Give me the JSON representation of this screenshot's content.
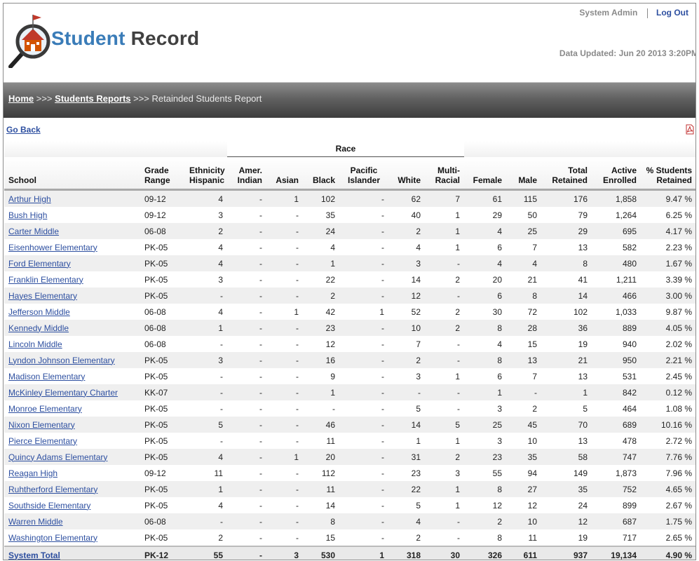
{
  "header": {
    "logo_word1": "Student",
    "logo_word2": "Record",
    "user": "System Admin",
    "logout": "Log Out",
    "updated": "Data Updated: Jun 20 2013 3:20PM"
  },
  "breadcrumb": {
    "home": "Home",
    "sep": ">>>",
    "reports": "Students Reports",
    "current": "Retainded Students Report"
  },
  "goback": "Go Back",
  "icons": {
    "pdf": "pdf-icon",
    "logo": "schoolhouse-magnifier-icon"
  },
  "colors": {
    "link": "#2d4fa0",
    "logo_blue": "#3a7cb8",
    "bar_dark": "#3d3d3d"
  },
  "table": {
    "race_header": "Race",
    "columns": [
      "School",
      "Grade Range",
      "Ethnicity Hispanic",
      "Amer. Indian",
      "Asian",
      "Black",
      "Pacific Islander",
      "White",
      "Multi-Racial",
      "Female",
      "Male",
      "Total Retained",
      "Active Enrolled",
      "% Students Retained"
    ],
    "rows": [
      [
        "Arthur High",
        "09-12",
        "4",
        "-",
        "1",
        "102",
        "-",
        "62",
        "7",
        "61",
        "115",
        "176",
        "1,858",
        "9.47 %"
      ],
      [
        "Bush High",
        "09-12",
        "3",
        "-",
        "-",
        "35",
        "-",
        "40",
        "1",
        "29",
        "50",
        "79",
        "1,264",
        "6.25 %"
      ],
      [
        "Carter Middle",
        "06-08",
        "2",
        "-",
        "-",
        "24",
        "-",
        "2",
        "1",
        "4",
        "25",
        "29",
        "695",
        "4.17 %"
      ],
      [
        "Eisenhower Elementary",
        "PK-05",
        "4",
        "-",
        "-",
        "4",
        "-",
        "4",
        "1",
        "6",
        "7",
        "13",
        "582",
        "2.23 %"
      ],
      [
        "Ford Elementary",
        "PK-05",
        "4",
        "-",
        "-",
        "1",
        "-",
        "3",
        "-",
        "4",
        "4",
        "8",
        "480",
        "1.67 %"
      ],
      [
        "Franklin Elementary",
        "PK-05",
        "3",
        "-",
        "-",
        "22",
        "-",
        "14",
        "2",
        "20",
        "21",
        "41",
        "1,211",
        "3.39 %"
      ],
      [
        "Hayes Elementary",
        "PK-05",
        "-",
        "-",
        "-",
        "2",
        "-",
        "12",
        "-",
        "6",
        "8",
        "14",
        "466",
        "3.00 %"
      ],
      [
        "Jefferson Middle",
        "06-08",
        "4",
        "-",
        "1",
        "42",
        "1",
        "52",
        "2",
        "30",
        "72",
        "102",
        "1,033",
        "9.87 %"
      ],
      [
        "Kennedy Middle",
        "06-08",
        "1",
        "-",
        "-",
        "23",
        "-",
        "10",
        "2",
        "8",
        "28",
        "36",
        "889",
        "4.05 %"
      ],
      [
        "Lincoln Middle",
        "06-08",
        "-",
        "-",
        "-",
        "12",
        "-",
        "7",
        "-",
        "4",
        "15",
        "19",
        "940",
        "2.02 %"
      ],
      [
        "Lyndon Johnson Elementary",
        "PK-05",
        "3",
        "-",
        "-",
        "16",
        "-",
        "2",
        "-",
        "8",
        "13",
        "21",
        "950",
        "2.21 %"
      ],
      [
        "Madison Elementary",
        "PK-05",
        "-",
        "-",
        "-",
        "9",
        "-",
        "3",
        "1",
        "6",
        "7",
        "13",
        "531",
        "2.45 %"
      ],
      [
        "McKinley Elementary Charter",
        "KK-07",
        "-",
        "-",
        "-",
        "1",
        "-",
        "-",
        "-",
        "1",
        "-",
        "1",
        "842",
        "0.12 %"
      ],
      [
        "Monroe Elementary",
        "PK-05",
        "-",
        "-",
        "-",
        "-",
        "-",
        "5",
        "-",
        "3",
        "2",
        "5",
        "464",
        "1.08 %"
      ],
      [
        "Nixon Elementary",
        "PK-05",
        "5",
        "-",
        "-",
        "46",
        "-",
        "14",
        "5",
        "25",
        "45",
        "70",
        "689",
        "10.16 %"
      ],
      [
        "Pierce Elementary",
        "PK-05",
        "-",
        "-",
        "-",
        "11",
        "-",
        "1",
        "1",
        "3",
        "10",
        "13",
        "478",
        "2.72 %"
      ],
      [
        "Quincy Adams Elementary",
        "PK-05",
        "4",
        "-",
        "1",
        "20",
        "-",
        "31",
        "2",
        "23",
        "35",
        "58",
        "747",
        "7.76 %"
      ],
      [
        "Reagan High",
        "09-12",
        "11",
        "-",
        "-",
        "112",
        "-",
        "23",
        "3",
        "55",
        "94",
        "149",
        "1,873",
        "7.96 %"
      ],
      [
        "Ruhtherford Elementary",
        "PK-05",
        "1",
        "-",
        "-",
        "11",
        "-",
        "22",
        "1",
        "8",
        "27",
        "35",
        "752",
        "4.65 %"
      ],
      [
        "Southside Elementary",
        "PK-05",
        "4",
        "-",
        "-",
        "14",
        "-",
        "5",
        "1",
        "12",
        "12",
        "24",
        "899",
        "2.67 %"
      ],
      [
        "Warren Middle",
        "06-08",
        "-",
        "-",
        "-",
        "8",
        "-",
        "4",
        "-",
        "2",
        "10",
        "12",
        "687",
        "1.75 %"
      ],
      [
        "Washington Elementary",
        "PK-05",
        "2",
        "-",
        "-",
        "15",
        "-",
        "2",
        "-",
        "8",
        "11",
        "19",
        "717",
        "2.65 %"
      ]
    ],
    "total": [
      "System Total",
      "PK-12",
      "55",
      "-",
      "3",
      "530",
      "1",
      "318",
      "30",
      "326",
      "611",
      "937",
      "19,134",
      "4.90 %"
    ]
  }
}
